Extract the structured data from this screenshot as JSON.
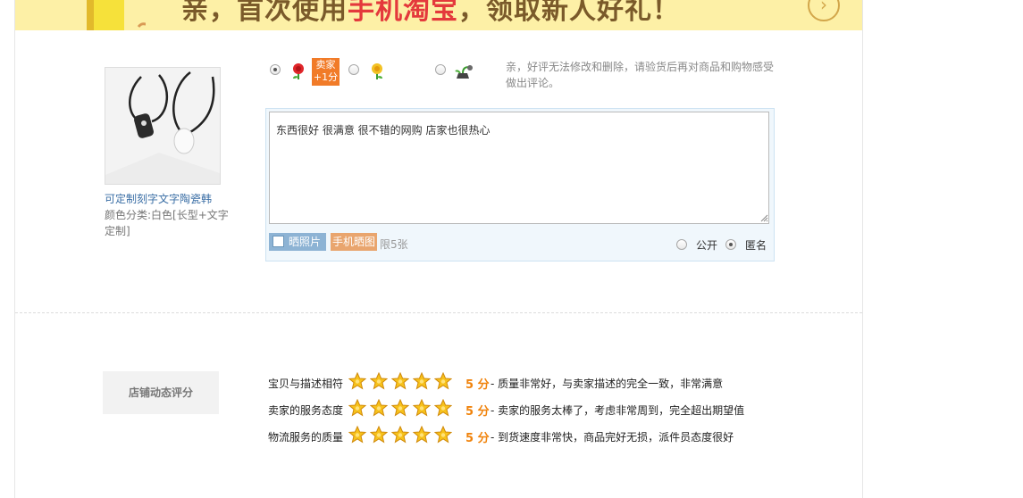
{
  "banner": {
    "prefix": "亲，首次使用",
    "highlight": "手机淘宝",
    "suffix": "，领取新人好礼！",
    "arrow_icon": "circle-arrow-right-icon"
  },
  "item": {
    "title": "可定制刻字文字陶瓷韩",
    "spec": "颜色分类:白色[长型+文字定制]"
  },
  "rating": {
    "options": [
      {
        "name": "good",
        "icon": "red-flower-icon",
        "checked": true
      },
      {
        "name": "neutral",
        "icon": "yellow-flower-icon",
        "checked": false
      },
      {
        "name": "bad",
        "icon": "wilted-flower-icon",
        "checked": false
      }
    ],
    "seller_badge": [
      "卖家",
      "+1分"
    ],
    "tip": "亲，好评无法修改和删除，请验货后再对商品和购物感受做出评论。"
  },
  "review": {
    "text": "东西很好 很满意 很不错的网购 店家也很热心"
  },
  "upload": {
    "photo_label": "晒照片",
    "mobile_label": "手机晒图",
    "limit": "限5张"
  },
  "visibility": {
    "public_label": "公开",
    "anonymous_label": "匿名",
    "selected": "anonymous"
  },
  "shop_rating": {
    "label": "店铺动态评分",
    "rows": [
      {
        "name": "宝贝与描述相符",
        "stars": 5,
        "score": "5 分",
        "desc": "- 质量非常好，与卖家描述的完全一致，非常满意"
      },
      {
        "name": "卖家的服务态度",
        "stars": 5,
        "score": "5 分",
        "desc": "- 卖家的服务太棒了，考虑非常周到，完全超出期望值"
      },
      {
        "name": "物流服务的质量",
        "stars": 5,
        "score": "5 分",
        "desc": "- 到货速度非常快，商品完好无损，派件员态度很好"
      }
    ]
  },
  "colors": {
    "banner_bg": "#fdf0a6",
    "accent_orange": "#f17b28",
    "score_orange": "#f0830c",
    "link_blue": "#3a6ea5"
  }
}
